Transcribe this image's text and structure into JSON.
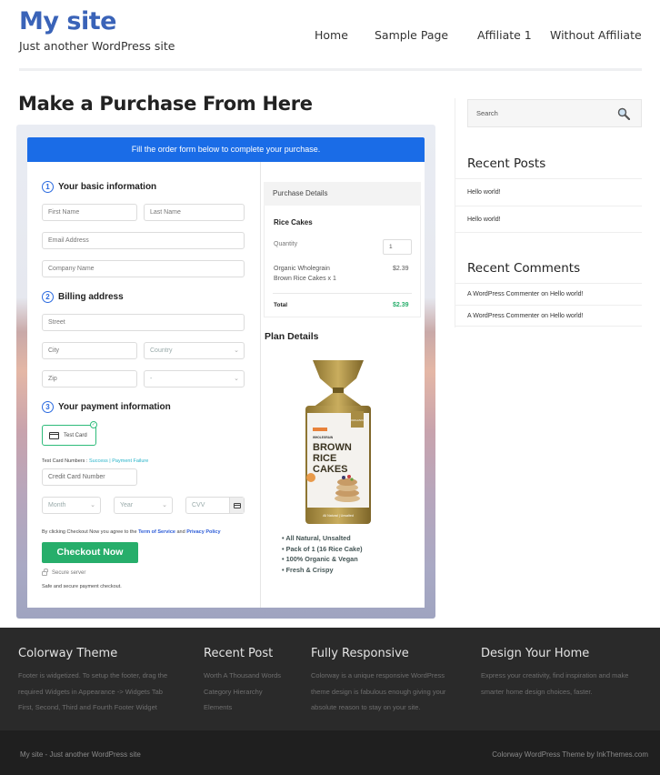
{
  "header": {
    "site_title": "My site",
    "tagline": "Just another WordPress site",
    "nav": [
      "Home",
      "Sample Page",
      "Affiliate 1",
      "Without Affiliate"
    ]
  },
  "page": {
    "title": "Make a Purchase From Here"
  },
  "form": {
    "banner": "Fill the order form below to complete your purchase.",
    "accent_color": "#1a6ce7",
    "step1": {
      "num": "1",
      "title": "Your basic information"
    },
    "step2": {
      "num": "2",
      "title": "Billing address"
    },
    "step3": {
      "num": "3",
      "title": "Your payment information"
    },
    "placeholders": {
      "first_name": "First Name",
      "last_name": "Last Name",
      "email": "Email Address",
      "company": "Company Name",
      "street": "Street",
      "city": "City",
      "country": "Country",
      "zip": "Zip",
      "state": "-",
      "card_number": "Credit Card Number",
      "month": "Month",
      "year": "Year",
      "cvv": "CVV"
    },
    "test_card_label": "Test Card",
    "test_numbers_label": "Test Card Numbers :",
    "test_success": "Success",
    "test_separator": "|",
    "test_failure": "Payment Failure",
    "agree_prefix": "By clicking Checkout Now you agree to the",
    "terms_link": "Term of Service",
    "agree_and": "and",
    "privacy_link": "Privacy Policy",
    "checkout_button": "Checkout Now",
    "checkout_color": "#27ae6b",
    "secure_server": "Secure server",
    "safe_note": "Safe and secure payment checkout."
  },
  "purchase": {
    "header": "Purchase Details",
    "product": "Rice Cakes",
    "quantity_label": "Quantity",
    "quantity_value": "1",
    "item_line1": "Organic Wholegrain",
    "item_line2": "Brown Rice Cakes x 1",
    "item_price": "$2.39",
    "total_label": "Total",
    "total_value": "$2.39",
    "total_color": "#27ae6b"
  },
  "plan": {
    "title": "Plan Details",
    "product_image_text": {
      "top": "WHOLEGRAIN",
      "line1": "BROWN",
      "line2": "RICE",
      "line3": "CAKES",
      "tag": "ORGANIC",
      "bottom": "All Natural | Unsalted"
    },
    "features": [
      "All Natural, Unsalted",
      "Pack of 1 (16 Rice Cake)",
      "100% Organic & Vegan",
      "Fresh & Crispy"
    ]
  },
  "sidebar": {
    "search_placeholder": "Search",
    "recent_posts_title": "Recent Posts",
    "recent_posts": [
      "Hello world!",
      "Hello world!"
    ],
    "recent_comments_title": "Recent Comments",
    "recent_comments": [
      {
        "author": "A WordPress Commenter",
        "on": "on",
        "post": "Hello world!"
      },
      {
        "author": "A WordPress Commenter",
        "on": "on",
        "post": "Hello world!"
      }
    ]
  },
  "footer": {
    "columns": [
      {
        "title": "Colorway Theme",
        "lines": [
          "Footer is widgetized. To setup the footer, drag the",
          "required Widgets in Appearance -> Widgets Tab",
          "First, Second, Third and Fourth Footer Widget"
        ]
      },
      {
        "title": "Recent Post",
        "lines": [
          "Worth A Thousand Words",
          "Category Hierarchy",
          "Elements"
        ]
      },
      {
        "title": "Fully Responsive",
        "lines": [
          "Colorway is a unique responsive WordPress",
          "theme design is fabulous enough giving your",
          "absolute reason to stay on your site."
        ]
      },
      {
        "title": "Design Your Home",
        "lines": [
          "Express your creativity, find inspiration and make",
          "smarter home design choices, faster."
        ]
      }
    ],
    "bottom_left": "My site - Just another WordPress site",
    "bottom_right": "Colorway WordPress Theme by InkThemes.com"
  }
}
